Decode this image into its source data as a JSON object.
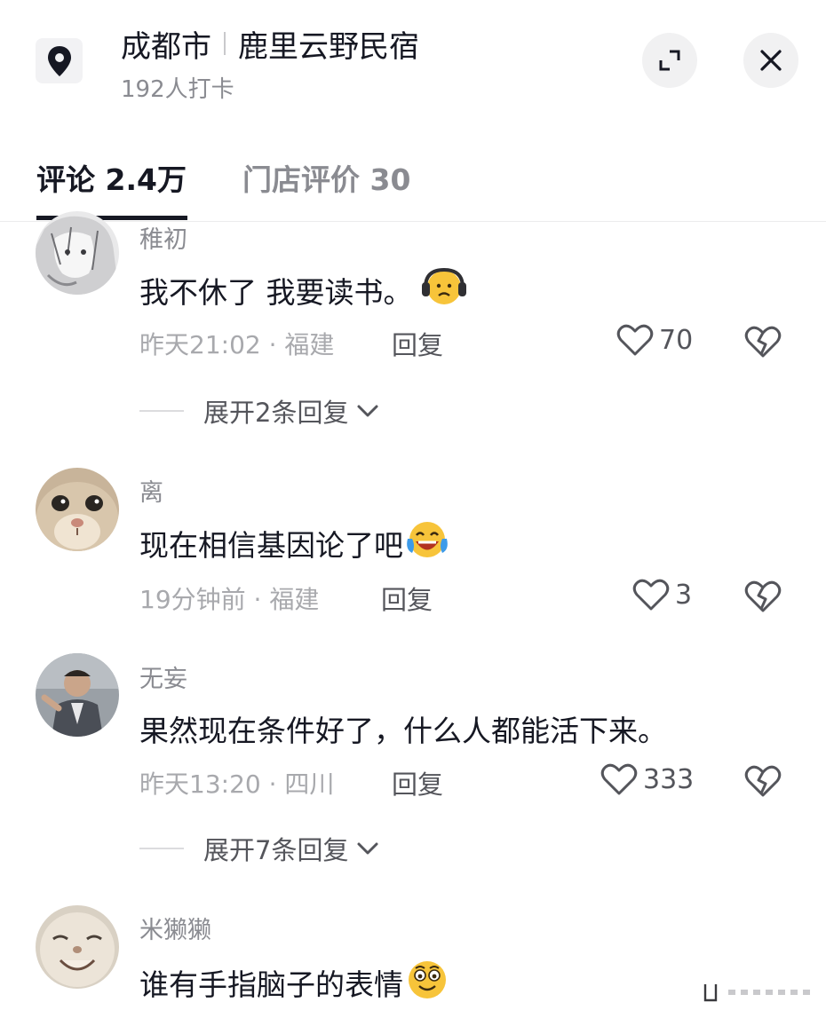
{
  "header": {
    "city": "成都市",
    "place": "鹿里云野民宿",
    "checkin": "192人打卡"
  },
  "tabs": [
    {
      "label": "评论 2.4万",
      "active": true
    },
    {
      "label": "门店评价 30",
      "active": false
    }
  ],
  "comments": [
    {
      "username": "稚初",
      "text": "我不休了 我要读书。",
      "emoji": "headphones-sad-emoji",
      "meta": "昨天21:02 · 福建",
      "reply": "回复",
      "likes": "70",
      "expand": "展开2条回复"
    },
    {
      "username": "离",
      "text": "现在相信基因论了吧",
      "emoji": "laughing-crying-emoji",
      "meta": "19分钟前 · 福建",
      "reply": "回复",
      "likes": "3",
      "expand": ""
    },
    {
      "username": "无妄",
      "text": "果然现在条件好了，什么人都能活下来。",
      "emoji": "",
      "meta": "昨天13:20 · 四川",
      "reply": "回复",
      "likes": "333",
      "expand": "展开7条回复"
    },
    {
      "username": "米獭獭",
      "text": "谁有手指脑子的表情",
      "emoji": "smiling-emoji",
      "meta": "",
      "reply": "",
      "likes": "",
      "expand": ""
    }
  ],
  "colors": {
    "primary_text": "#161823",
    "secondary_text": "#8a8b91",
    "meta_text": "#a8a9ad",
    "action_text": "#54555b"
  }
}
